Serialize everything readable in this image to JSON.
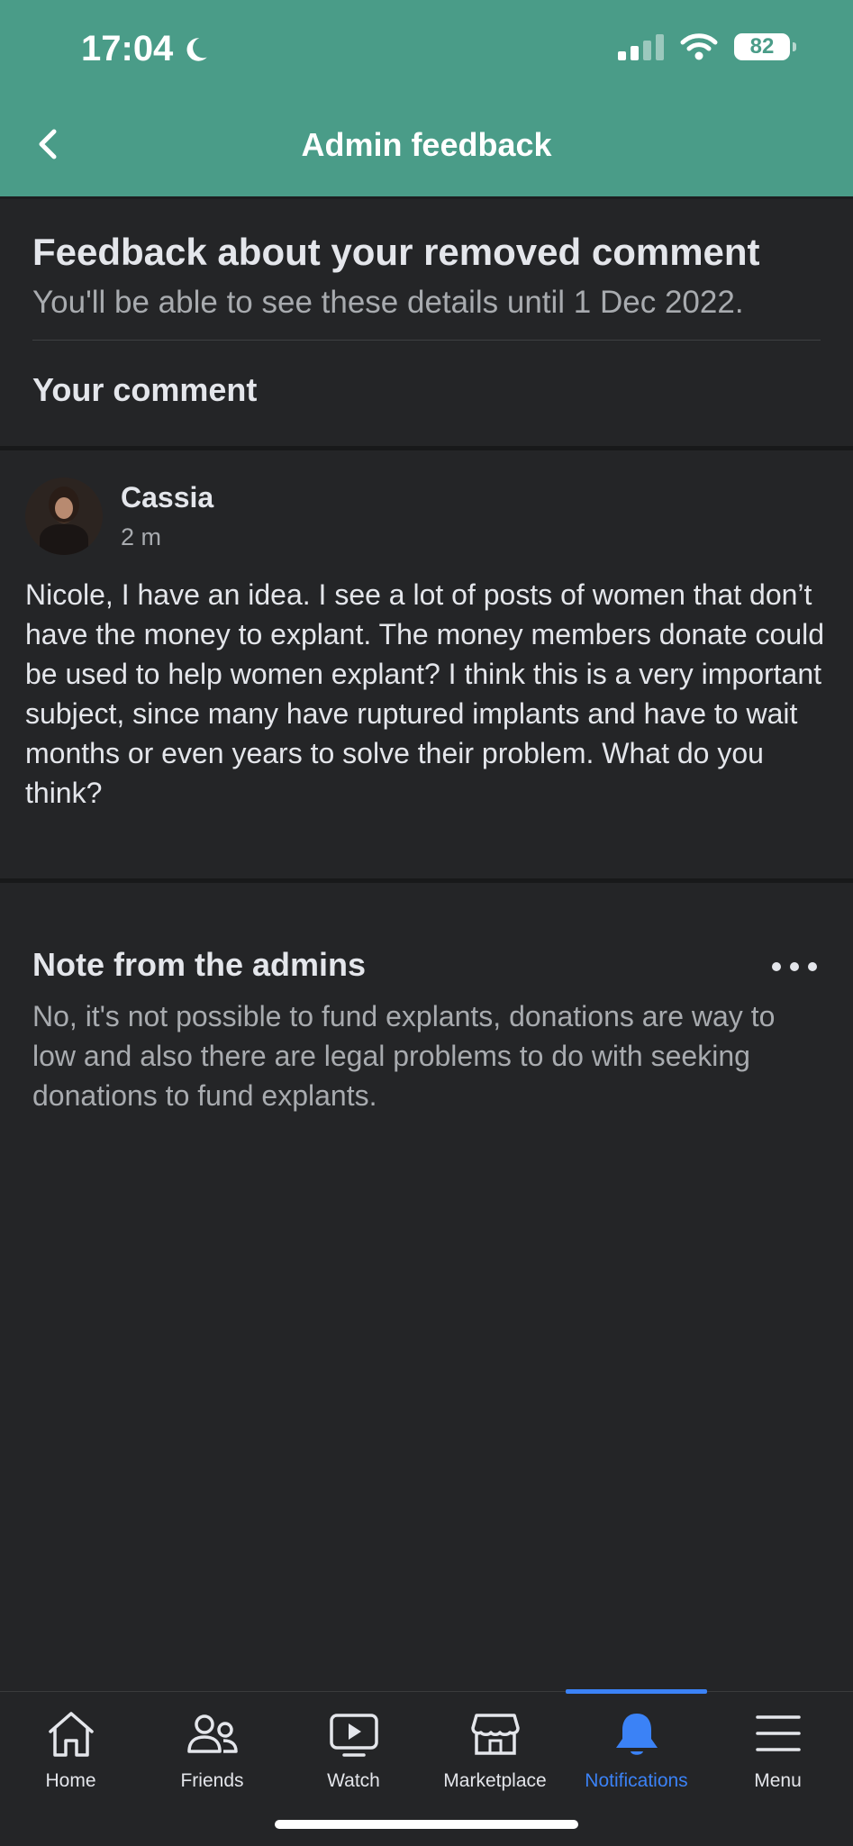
{
  "status_bar": {
    "time": "17:04",
    "battery": "82"
  },
  "nav": {
    "title": "Admin feedback"
  },
  "intro": {
    "title": "Feedback about your removed comment",
    "subtitle": "You'll be able to see these details until 1 Dec 2022."
  },
  "section_label": "Your comment",
  "comment": {
    "author": "Cassia",
    "time": "2 m",
    "text": "Nicole, I have an idea. I see a lot of posts of women that don’t have the money to explant. The money members donate could be used to help women explant? I think this is a very important subject, since many have ruptured implants and have to wait months or even years to solve their problem. What do you think?"
  },
  "note": {
    "title": "Note from the admins",
    "text": "No, it's not possible to fund explants, donations are way to low and also there are legal problems to do with seeking donations to fund explants."
  },
  "tabs": [
    {
      "label": "Home",
      "icon": "home-icon"
    },
    {
      "label": "Friends",
      "icon": "friends-icon"
    },
    {
      "label": "Watch",
      "icon": "watch-icon"
    },
    {
      "label": "Marketplace",
      "icon": "marketplace-icon"
    },
    {
      "label": "Notifications",
      "icon": "bell-icon",
      "active": true
    },
    {
      "label": "Menu",
      "icon": "menu-icon"
    }
  ],
  "colors": {
    "header": "#4a9c88",
    "background": "#242527",
    "accent": "#3b82f6"
  }
}
